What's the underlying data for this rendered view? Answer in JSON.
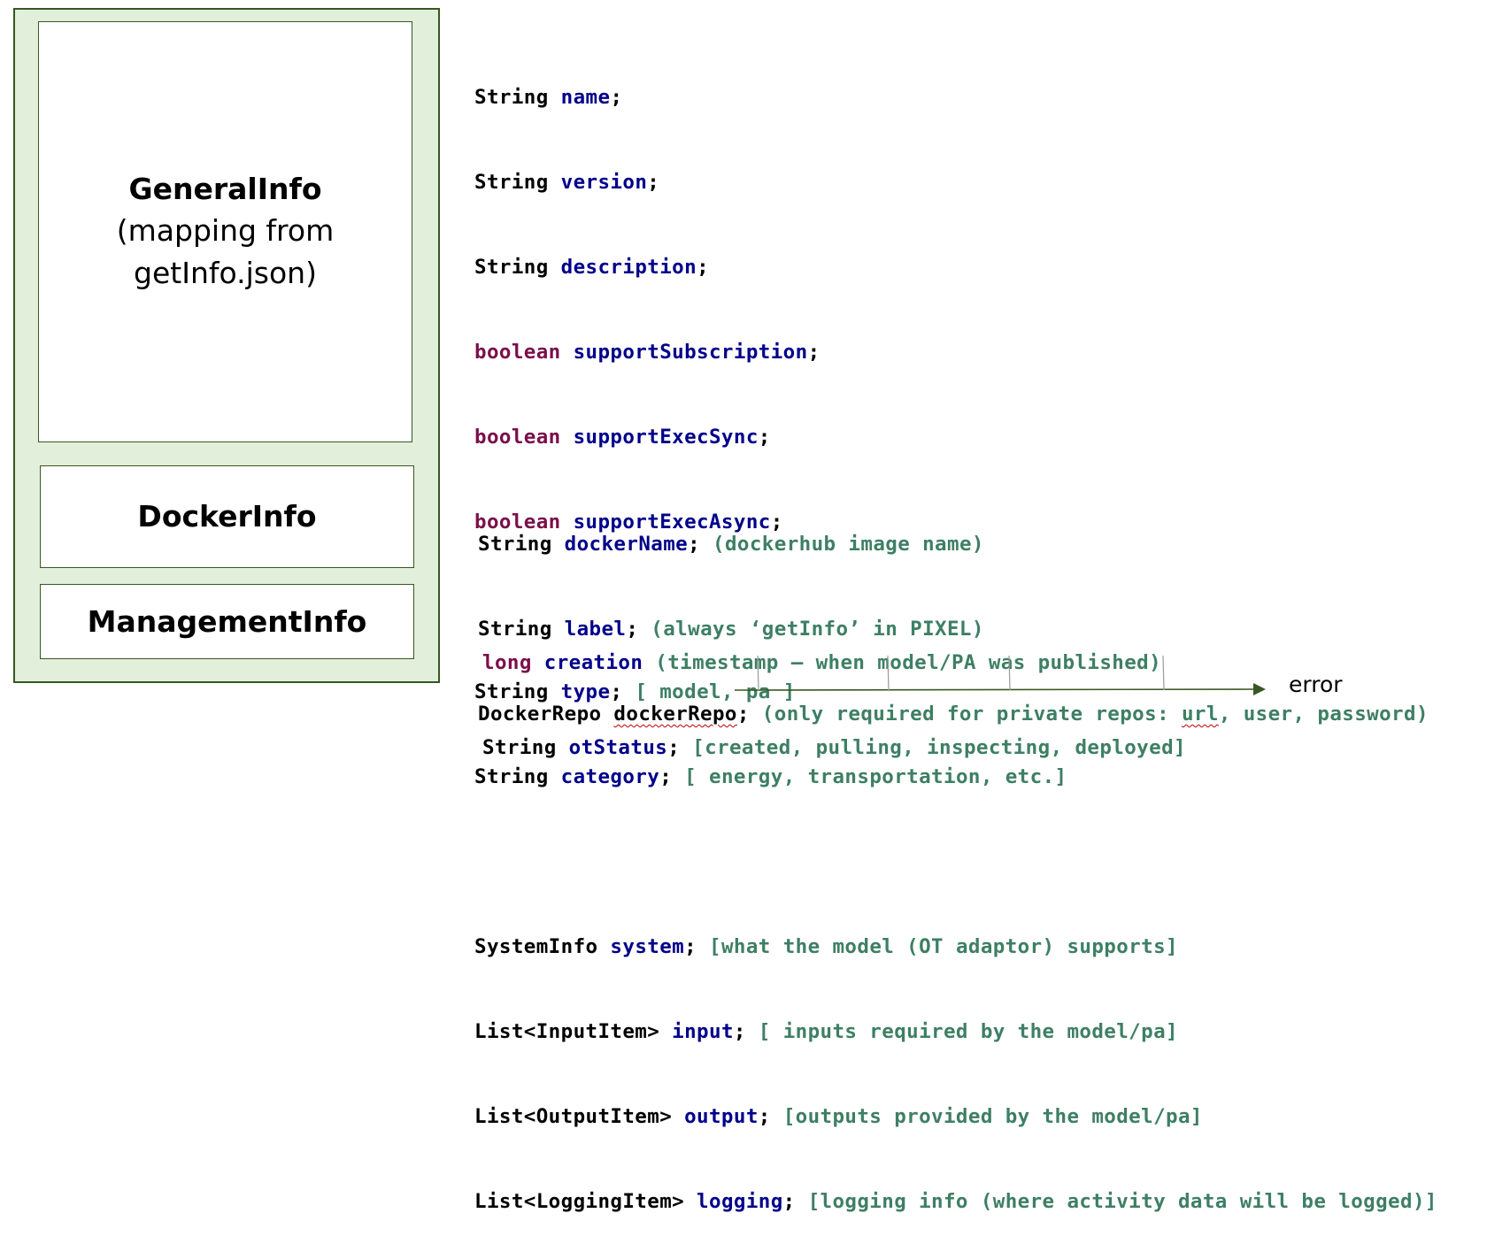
{
  "boxes": {
    "general": {
      "title": "GeneralInfo",
      "subtitle_1": "(mapping from",
      "subtitle_2": "getInfo.json)"
    },
    "docker": {
      "title": "DockerInfo"
    },
    "management": {
      "title": "ManagementInfo"
    }
  },
  "general_code": [
    {
      "type": "String",
      "field": "name",
      "punct": ";",
      "comment": ""
    },
    {
      "type": "String",
      "field": "version",
      "punct": ";",
      "comment": ""
    },
    {
      "type": "String",
      "field": "description",
      "punct": ";",
      "comment": ""
    },
    {
      "keyword": "boolean",
      "field": "supportSubscription",
      "punct": ";",
      "comment": ""
    },
    {
      "keyword": "boolean",
      "field": "supportExecSync",
      "punct": ";",
      "comment": ""
    },
    {
      "keyword": "boolean",
      "field": "supportExecAsync",
      "punct": ";",
      "comment": ""
    },
    {
      "type": "String",
      "field": "type",
      "punct": ";",
      "comment": "[ model, pa ]"
    },
    {
      "type": "String",
      "field": "category",
      "punct": ";",
      "comment": "[ energy, transportation, etc.]"
    },
    {
      "type": "SystemInfo",
      "field": "system",
      "punct": ";",
      "comment": "[what the model (OT adaptor) supports]"
    },
    {
      "type": "List<InputItem>",
      "field": "input",
      "punct": ";",
      "comment": "[ inputs required by the model/pa]"
    },
    {
      "type": "List<OutputItem>",
      "field": "output",
      "punct": ";",
      "comment": "[outputs provided by the model/pa]"
    },
    {
      "type": "List<LoggingItem>",
      "field": "logging",
      "punct": ";",
      "comment": "[logging info (where activity data will be logged)]"
    }
  ],
  "docker_code": [
    {
      "type": "String",
      "field": "dockerName",
      "punct": ";",
      "comment": "(dockerhub image name)"
    },
    {
      "type": "String",
      "field": "label",
      "punct": ";",
      "comment": "(always ‘getInfo’ in PIXEL)"
    },
    {
      "type": "DockerRepo",
      "field": "dockerRepo",
      "punct": ";",
      "comment_a": "(only required for private repos: ",
      "comment_b": "url",
      "comment_c": ", user, password)"
    }
  ],
  "management_code": [
    {
      "keyword": "long",
      "field": "creation",
      "punct": "",
      "comment": "(timestamp – when model/PA was published)"
    },
    {
      "type": "String",
      "field": "otStatus",
      "punct": ";",
      "comment": "[created, pulling, inspecting, deployed]"
    }
  ],
  "timeline": {
    "end_label": "error"
  },
  "colors": {
    "panel_fill": "#e2efda",
    "panel_border": "#385723",
    "keyword": "#7a0f4a",
    "field": "#00008b",
    "comment": "#3e7f64",
    "timeline": "#385723"
  }
}
